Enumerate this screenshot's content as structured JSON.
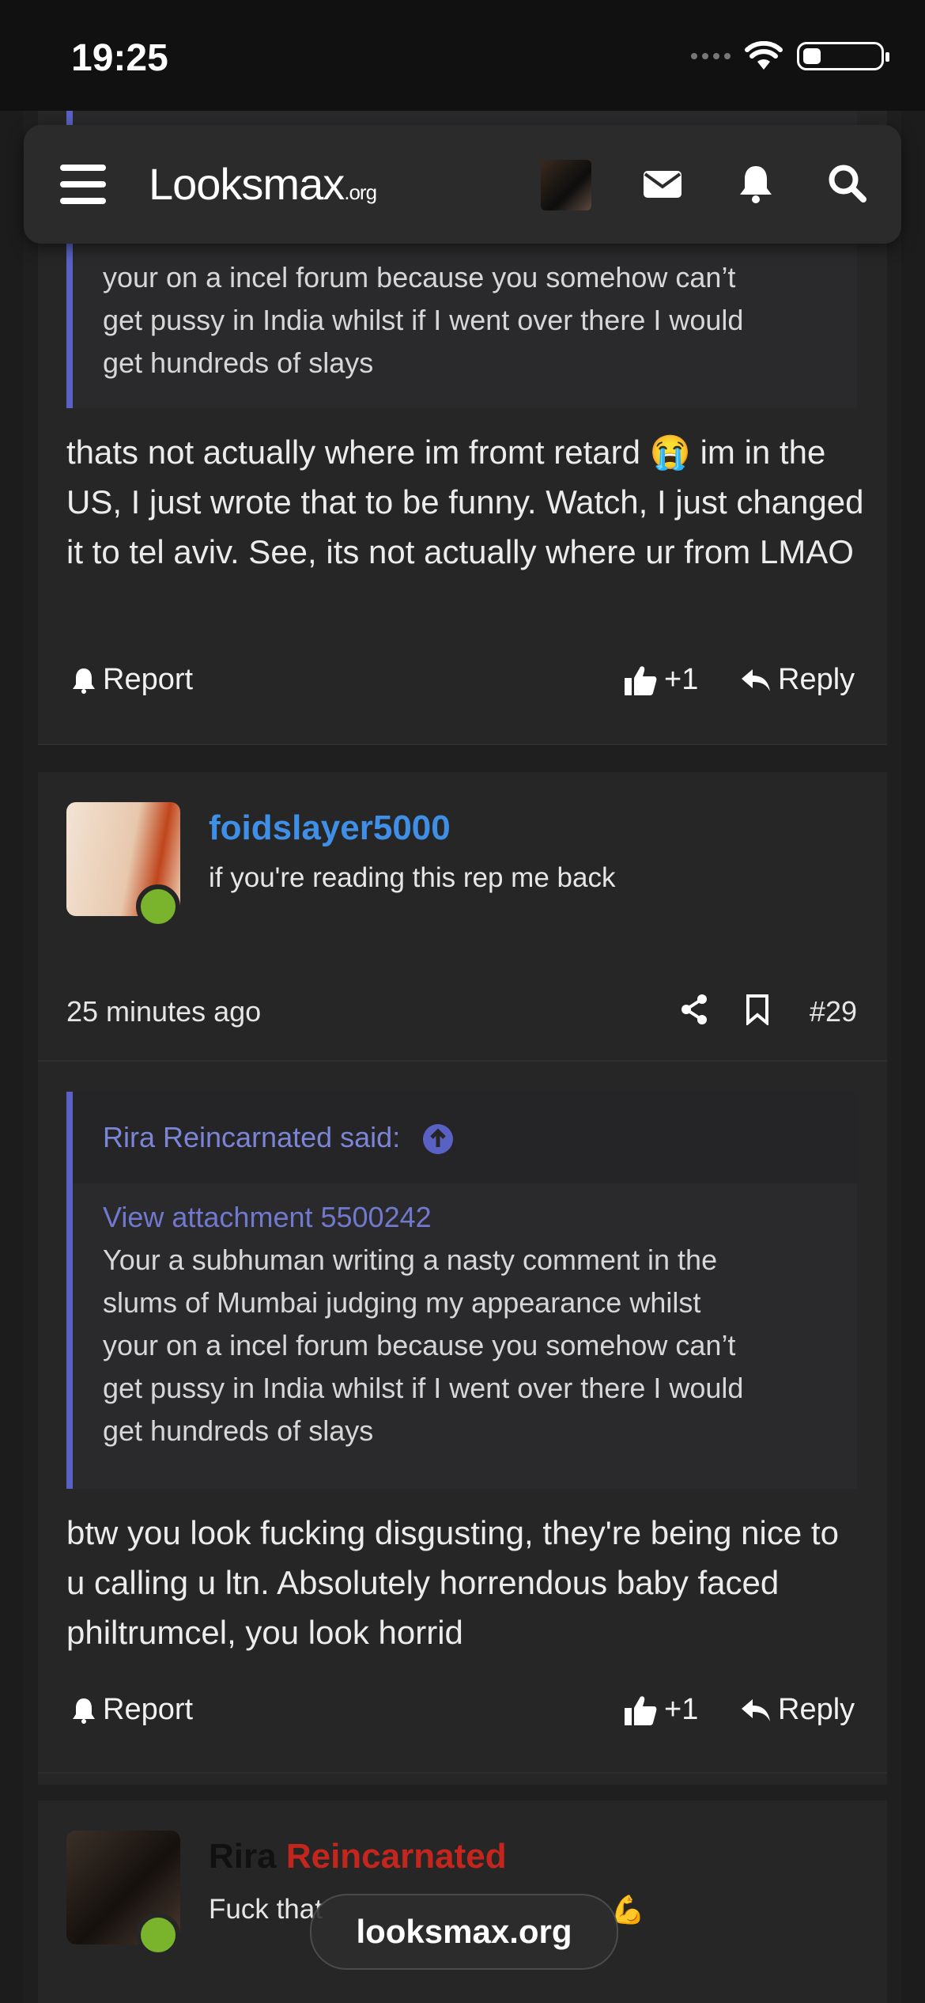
{
  "status_bar": {
    "time": "19:25"
  },
  "header": {
    "logo_main": "Looksmax",
    "logo_suffix": ".org"
  },
  "posts": [
    {
      "quote_visible_lines": [
        "your on a incel forum because you somehow can’t",
        "get pussy in India whilst if I went over there I would",
        "get hundreds of slays"
      ],
      "body": "thats not actually where im fromt retard 😭 im in the US, I just wrote that to be funny. Watch, I just changed it to tel aviv. See, its not actually where ur from LMAO",
      "actions": {
        "report": "Report",
        "like_count": "+1",
        "reply": "Reply"
      }
    },
    {
      "username": "foidslayer5000",
      "user_title": "if you're reading this rep me back",
      "time_ago": "25 minutes ago",
      "post_number": "#29",
      "quote_author": "Rira Reincarnated said:",
      "attachment": "View attachment 5500242",
      "quote_lines": [
        "Your a subhuman writing a nasty comment in the",
        "slums of Mumbai judging my appearance whilst",
        "your on a incel forum because you somehow can’t",
        "get pussy in India whilst if I went over there I would",
        "get hundreds of slays"
      ],
      "body": "btw you look fucking disgusting, they're being nice to u calling u ltn. Absolutely horrendous baby faced philtrumcel, you look horrid",
      "actions": {
        "report": "Report",
        "like_count": "+1",
        "reply": "Reply"
      }
    },
    {
      "username_part1": "Rira",
      "username_part2": "Reincarnated",
      "user_title": "Fuck that",
      "user_title_emoji": "💪"
    }
  ],
  "toast": {
    "text": "looksmax.org"
  },
  "colors": {
    "accent": "#5961c4",
    "username_blue": "#3f8fe6",
    "online": "#7ab42c",
    "username_red": "#c4261d"
  }
}
